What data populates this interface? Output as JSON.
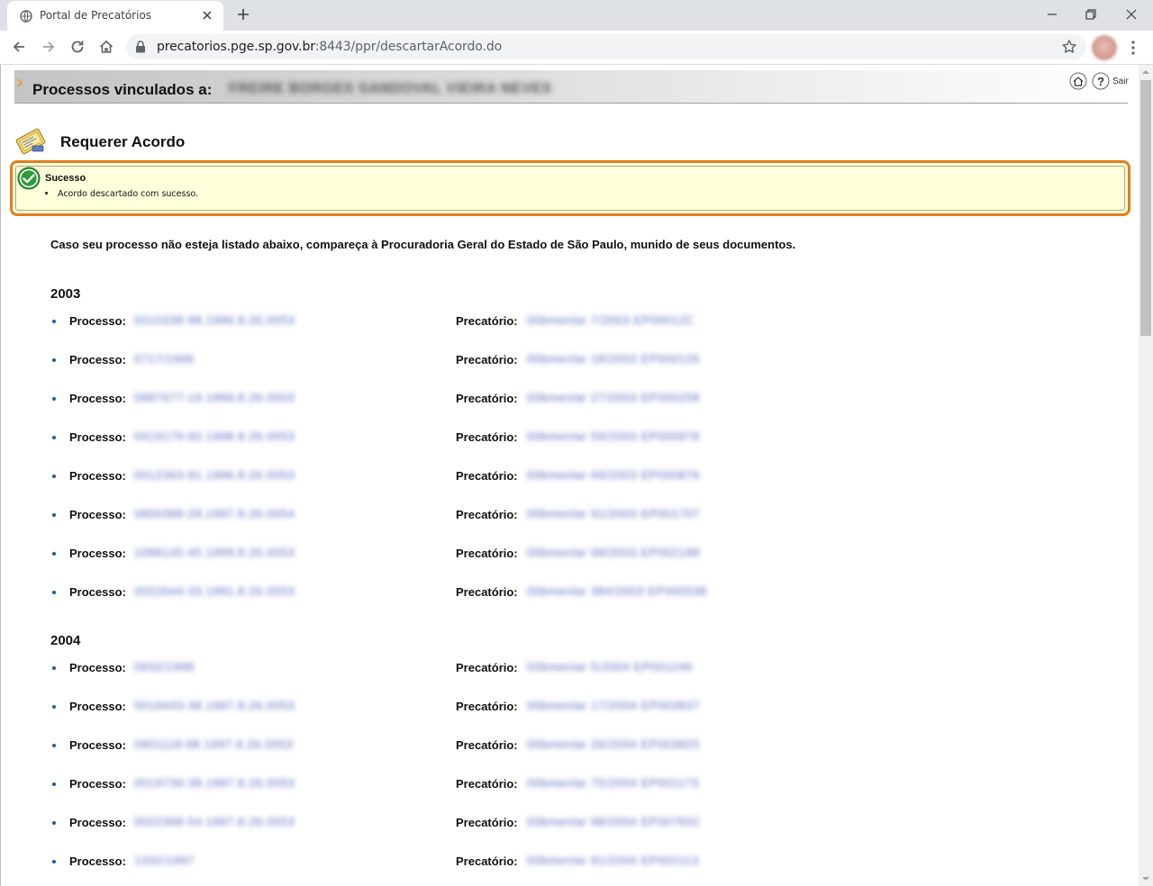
{
  "browser": {
    "tab_title": "Portal de Precatórios",
    "url_host": "precatorios.pge.sp.gov.br",
    "url_rest": ":8443/ppr/descartarAcordo.do"
  },
  "header": {
    "title": "Processos vinculados a:",
    "name": "FREIRE BORGES SANDOVAL VIEIRA NEVES",
    "sair_label": "Sair"
  },
  "page": {
    "title": "Requerer Acordo",
    "success_title": "Sucesso",
    "success_message": "Acordo descartado com sucesso.",
    "notice": "Caso seu processo não esteja listado abaixo, compareça à Procuradoria Geral do Estado de São Paulo, munido de seus documentos."
  },
  "labels": {
    "processo": "Processo:",
    "precatorio": "Precatório:"
  },
  "groups": [
    {
      "year": "2003",
      "rows": [
        {
          "processo": "0010338-98.1996.8.26.0053",
          "precatorio": "00bmenlar 7/2003 EP00012C"
        },
        {
          "processo": "0717/1996",
          "precatorio": "00bmenlar 18/2003 EP000126"
        },
        {
          "processo": "0987677-19.1999.8.26.0003",
          "precatorio": "00bmenlar 27/2003 EP000258"
        },
        {
          "processo": "0419179-92.1998.8.26.0053",
          "precatorio": "00bmenlar 59/2003 EP000978"
        },
        {
          "processo": "0012363-91.1996.8.26.0053",
          "precatorio": "00bmenlar 69/2003 EP000876"
        },
        {
          "processo": "0900388-28.1997.8.26.0054",
          "precatorio": "00bmenlar 91/2003 EP001707"
        },
        {
          "processo": "1088145-45.1999.8.26.0053",
          "precatorio": "00bmenlar 99/2003 EP002198"
        },
        {
          "processo": "0022644-33.1991.8.26.0553",
          "precatorio": "00bmenlar 384/2003 EP000538"
        }
      ]
    },
    {
      "year": "2004",
      "rows": [
        {
          "processo": "0932/1998",
          "precatorio": "00bmenlar 5/2004 EP001246"
        },
        {
          "processo": "0019443-38.1997.8.26.0053",
          "precatorio": "00bmenlar 17/2004 EP003837"
        },
        {
          "processo": "0901118-88.1997.8.26.0053",
          "precatorio": "00bmenlar 26/2004 EP003825"
        },
        {
          "processo": "0019739-38.1997.8.26.0053",
          "precatorio": "00bmenlar 75/2004 EP001173"
        },
        {
          "processo": "0022398-54.1997.8.26.0053",
          "precatorio": "00bmenlar 98/2004 EP007832"
        },
        {
          "processo": "1332/1997",
          "precatorio": "00bmenlar 91/2004 EP002113"
        }
      ]
    }
  ],
  "colors": {
    "accent_border": "#e17e1e",
    "success_bg": "#ffffdc",
    "success_check": "#2e9a3b",
    "bullet": "#1a5fa0"
  },
  "icons": [
    "globe-icon",
    "close-icon",
    "plus-icon",
    "minimize-icon",
    "restore-icon",
    "window-close-icon",
    "back-icon",
    "forward-icon",
    "reload-icon",
    "home-icon",
    "lock-icon",
    "star-icon",
    "menu-dots-icon",
    "arrow-icon",
    "home-round-icon",
    "help-icon",
    "agreement-icon",
    "check-icon"
  ]
}
